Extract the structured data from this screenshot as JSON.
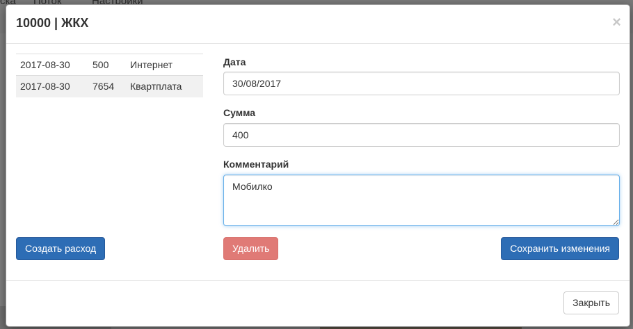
{
  "background": {
    "nav_items": [
      "ска",
      "Поток",
      "Настройки"
    ]
  },
  "modal": {
    "title": "10000 | ЖКХ",
    "close_label": "×",
    "transactions": [
      {
        "date": "2017-08-30",
        "amount": "500",
        "category": "Интернет"
      },
      {
        "date": "2017-08-30",
        "amount": "7654",
        "category": "Квартплата"
      }
    ],
    "form": {
      "date_label": "Дата",
      "date_value": "30/08/2017",
      "amount_label": "Сумма",
      "amount_value": "400",
      "comment_label": "Комментарий",
      "comment_value": "Мобилко"
    },
    "buttons": {
      "create_expense": "Создать расход",
      "delete": "Удалить",
      "save_changes": "Сохранить изменения",
      "close": "Закрыть"
    }
  },
  "colors": {
    "primary": "#2d6db5",
    "danger": "#e07a76",
    "focus": "#66afe9"
  }
}
